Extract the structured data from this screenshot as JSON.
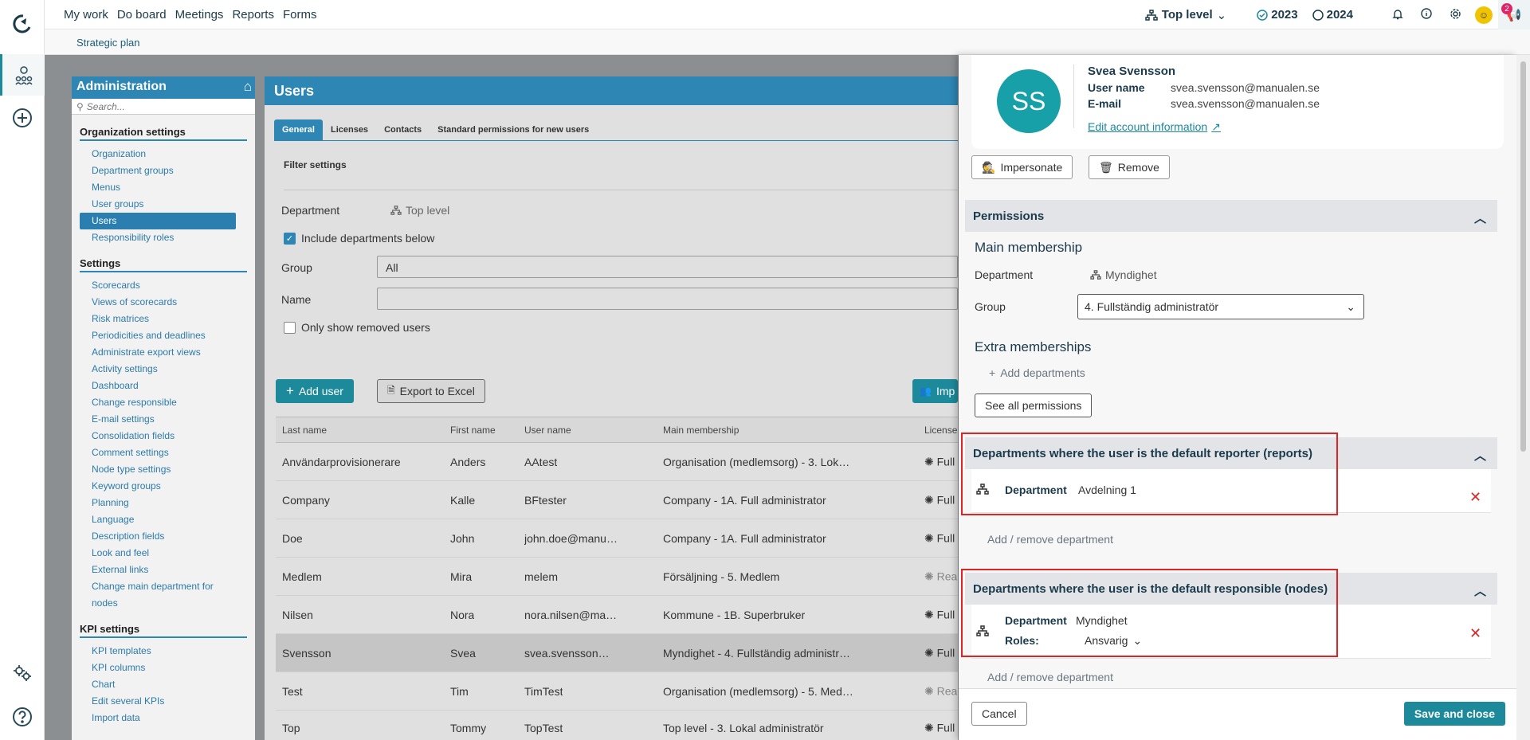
{
  "nav": {
    "items": [
      "My work",
      "Do board",
      "Meetings",
      "Reports",
      "Forms"
    ],
    "level_label": "Top level",
    "year_2023": "2023",
    "year_2024": "2024",
    "notification_count": "2"
  },
  "subnav": {
    "label": "Strategic plan"
  },
  "admin": {
    "title": "Administration",
    "search_placeholder": "Search...",
    "sections": [
      {
        "title": "Organization settings",
        "items": [
          "Organization",
          "Department groups",
          "Menus",
          "User groups",
          "Users",
          "Responsibility roles"
        ]
      },
      {
        "title": "Settings",
        "items": [
          "Scorecards",
          "Views of scorecards",
          "Risk matrices",
          "Periodicities and deadlines",
          "Administrate export views",
          "Activity settings",
          "Dashboard",
          "Change responsible",
          "E-mail settings",
          "Consolidation fields",
          "Comment settings",
          "Node type settings",
          "Keyword groups",
          "Planning",
          "Language",
          "Description fields",
          "Look and feel",
          "External links",
          "Change main department for",
          "nodes"
        ]
      },
      {
        "title": "KPI settings",
        "items": [
          "KPI templates",
          "KPI columns",
          "Chart",
          "Edit several KPIs",
          "Import data"
        ]
      }
    ]
  },
  "users": {
    "title": "Users",
    "tabs": [
      "General",
      "Licenses",
      "Contacts",
      "Standard permissions for new users"
    ],
    "filter_title": "Filter settings",
    "department_label": "Department",
    "department_value": "Top level",
    "include_below": "Include departments below",
    "group_label": "Group",
    "group_value": "All",
    "name_label": "Name",
    "only_removed": "Only show removed users",
    "add_user": "Add user",
    "export_excel": "Export to Excel",
    "import_label": "Imp",
    "columns": [
      "Last name",
      "First name",
      "User name",
      "Main membership",
      "License"
    ],
    "rows": [
      {
        "last": "Användarprovisionerare",
        "first": "Anders",
        "user": "AAtest",
        "membership": "Organisation (medlemsorg) - 3. Lok…",
        "license": "Full"
      },
      {
        "last": "Company",
        "first": "Kalle",
        "user": "BFtester",
        "membership": "Company - 1A. Full administrator",
        "license": "Full"
      },
      {
        "last": "Doe",
        "first": "John",
        "user": "john.doe@manu…",
        "membership": "Company - 1A. Full administrator",
        "license": "Full"
      },
      {
        "last": "Medlem",
        "first": "Mira",
        "user": "melem",
        "membership": "Försäljning - 5. Medlem",
        "license": "Rea"
      },
      {
        "last": "Nilsen",
        "first": "Nora",
        "user": "nora.nilsen@ma…",
        "membership": "Kommune - 1B. Superbruker",
        "license": "Full"
      },
      {
        "last": "Svensson",
        "first": "Svea",
        "user": "svea.svensson…",
        "membership": "Myndighet - 4. Fullständig administr…",
        "license": "Full"
      },
      {
        "last": "Test",
        "first": "Tim",
        "user": "TimTest",
        "membership": "Organisation (medlemsorg) - 5. Med…",
        "license": "Rea"
      },
      {
        "last": "Top",
        "first": "Tommy",
        "user": "TopTest",
        "membership": "Top level - 3. Lokal administratör",
        "license": "Full"
      }
    ]
  },
  "panel": {
    "initials": "SS",
    "name": "Svea Svensson",
    "username_label": "User name",
    "username": "svea.svensson@manualen.se",
    "email_label": "E-mail",
    "email": "svea.svensson@manualen.se",
    "edit_account": "Edit account information",
    "impersonate": "Impersonate",
    "remove": "Remove",
    "permissions_title": "Permissions",
    "main_membership": "Main membership",
    "department_label": "Department",
    "department_value": "Myndighet",
    "group_label": "Group",
    "group_value": "4. Fullständig administratör",
    "extra_memberships": "Extra memberships",
    "add_departments": "Add departments",
    "see_all_permissions": "See all permissions",
    "reporter_title": "Departments where the user is the default reporter (reports)",
    "reporter_dept_label": "Department",
    "reporter_dept_value": "Avdelning 1",
    "add_remove_1": "Add / remove department",
    "responsible_title": "Departments where the user is the default responsible (nodes)",
    "resp_dept_label": "Department",
    "resp_dept_value": "Myndighet",
    "roles_label": "Roles:",
    "roles_value": "Ansvarig",
    "add_remove_2": "Add / remove department",
    "cancel": "Cancel",
    "save_close": "Save and close"
  },
  "colors": {
    "brand": "#2d86b3",
    "teal": "#1c8a9a",
    "error": "#e02424"
  }
}
